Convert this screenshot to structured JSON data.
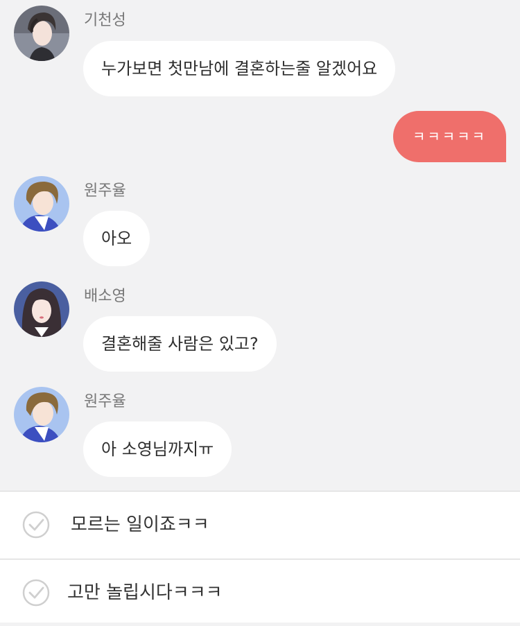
{
  "messages": [
    {
      "sender": "기천성",
      "text": "누가보면 첫만남에 결혼하는줄 알겠어요",
      "avatar": "man-dark-hair-avatar"
    },
    {
      "sender": "",
      "text": "ㅋㅋㅋㅋㅋ",
      "mine": true
    },
    {
      "sender": "원주율",
      "text": "아오",
      "avatar": "man-brown-hair-avatar"
    },
    {
      "sender": "배소영",
      "text": "결혼해줄 사람은 있고?",
      "avatar": "woman-long-hair-avatar"
    },
    {
      "sender": "원주율",
      "text": "아 소영님까지ㅠ",
      "avatar": "man-brown-hair-avatar"
    }
  ],
  "choices": [
    {
      "label": "모르는 일이죠ㅋㅋ",
      "icon": "check-circle-icon"
    },
    {
      "label": "고만 놀립시다ㅋㅋㅋ",
      "icon": "check-circle-icon"
    }
  ],
  "colors": {
    "background": "#f2f2f3",
    "my_bubble": "#ef6f6b",
    "other_bubble": "#ffffff"
  }
}
